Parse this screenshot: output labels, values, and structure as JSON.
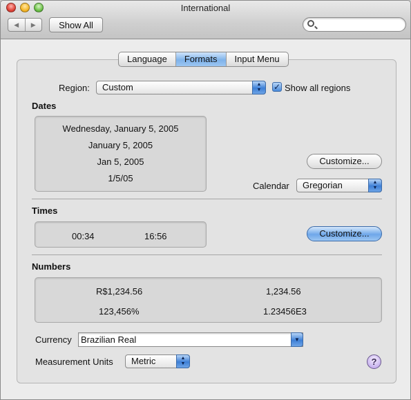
{
  "window": {
    "title": "International"
  },
  "toolbar": {
    "back_icon": "back-arrow-icon",
    "forward_icon": "forward-arrow-icon",
    "show_all_label": "Show All",
    "search_placeholder": ""
  },
  "tabs": [
    {
      "label": "Language",
      "selected": false
    },
    {
      "label": "Formats",
      "selected": true
    },
    {
      "label": "Input Menu",
      "selected": false
    }
  ],
  "region": {
    "label": "Region:",
    "value": "Custom",
    "show_all_regions_label": "Show all regions",
    "show_all_regions_checked": true
  },
  "dates": {
    "heading": "Dates",
    "examples": [
      "Wednesday, January 5, 2005",
      "January 5, 2005",
      "Jan 5, 2005",
      "1/5/05"
    ],
    "customize_label": "Customize...",
    "calendar_label": "Calendar",
    "calendar_value": "Gregorian"
  },
  "times": {
    "heading": "Times",
    "examples": [
      "00:34",
      "16:56"
    ],
    "customize_label": "Customize..."
  },
  "numbers": {
    "heading": "Numbers",
    "examples": [
      "R$1,234.56",
      "1,234.56",
      "123,456%",
      "1.23456E3"
    ]
  },
  "currency": {
    "label": "Currency",
    "value": "Brazilian Real"
  },
  "measurement": {
    "label": "Measurement Units",
    "value": "Metric"
  },
  "help": {
    "label": "?"
  },
  "colors": {
    "accent_blue": "#6ea7ea",
    "window_bg": "#ececec",
    "help_purple": "#c8b3ee"
  }
}
